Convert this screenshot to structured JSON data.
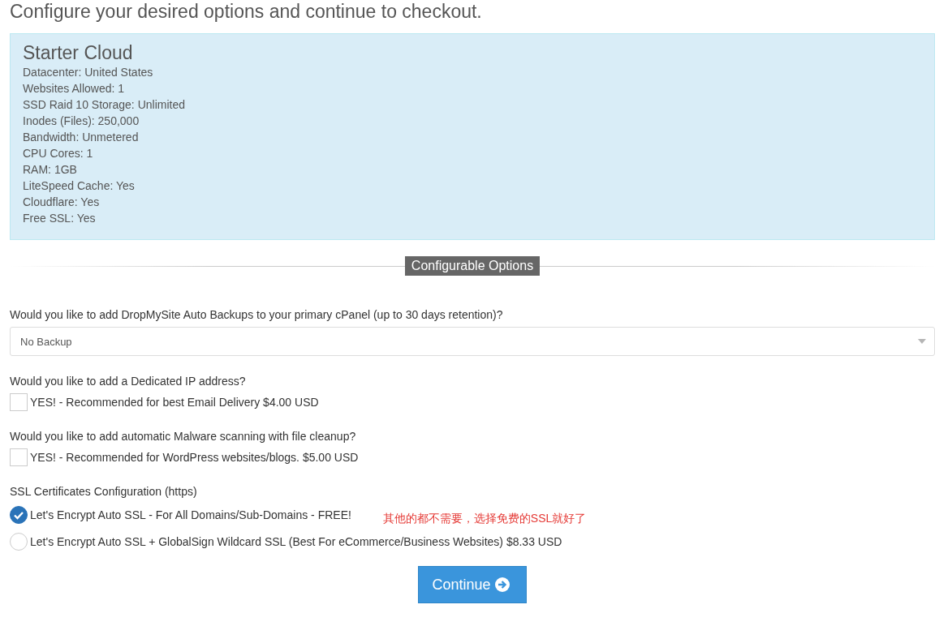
{
  "heading": "Configure your desired options and continue to checkout.",
  "product": {
    "name": "Starter Cloud",
    "features": [
      "Datacenter: United States",
      "Websites Allowed: 1",
      "SSD Raid 10 Storage: Unlimited",
      "Inodes (Files): 250,000",
      "Bandwidth: Unmetered",
      "CPU Cores: 1",
      "RAM: 1GB",
      "LiteSpeed Cache: Yes",
      "Cloudflare: Yes",
      "Free SSL: Yes"
    ]
  },
  "section_title": "Configurable Options",
  "options": [
    {
      "kind": "select",
      "question": "Would you like to add DropMySite Auto Backups to your primary cPanel (up to 30 days retention)?",
      "value": "No Backup"
    },
    {
      "kind": "checkbox",
      "question": "Would you like to add a Dedicated IP address?",
      "label": "YES! - Recommended for best Email Delivery $4.00 USD",
      "checked": false
    },
    {
      "kind": "checkbox",
      "question": "Would you like to add automatic Malware scanning with file cleanup?",
      "label": "YES! - Recommended for WordPress websites/blogs. $5.00 USD",
      "checked": false
    },
    {
      "kind": "radio",
      "question": "SSL Certificates Configuration (https)",
      "choices": [
        {
          "label": "Let's Encrypt Auto SSL - For All Domains/Sub-Domains - FREE!",
          "selected": true,
          "note": "其他的都不需要，选择免费的SSL就好了"
        },
        {
          "label": "Let's Encrypt Auto SSL + GlobalSign Wildcard SSL (Best For eCommerce/Business Websites) $8.33 USD",
          "selected": false
        }
      ]
    }
  ],
  "continue_button": {
    "label": "Continue"
  }
}
